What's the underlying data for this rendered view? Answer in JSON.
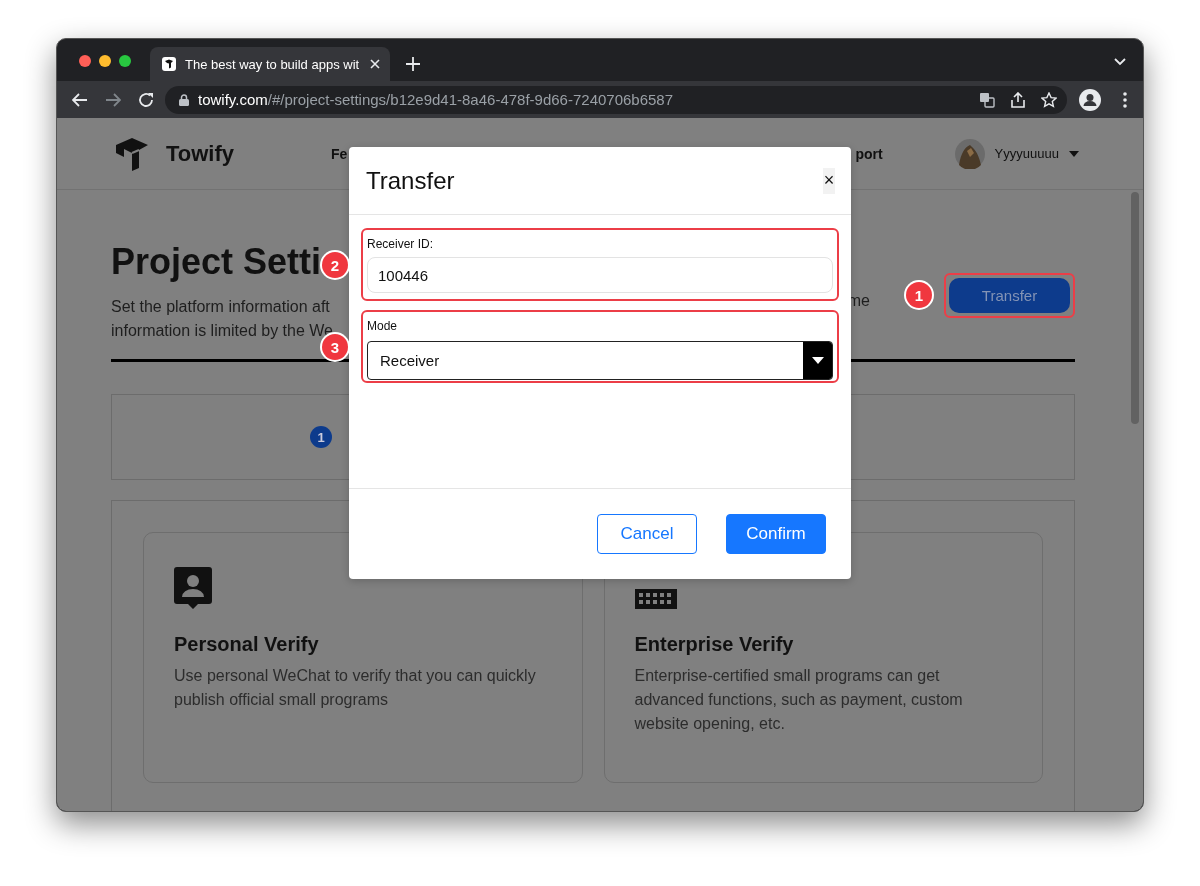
{
  "browser": {
    "tab_title": "The best way to build apps wit",
    "url_host": "towify.com",
    "url_path": "/#/project-settings/b12e9d41-8a46-478f-9d66-7240706b6587",
    "forward_disabled": true
  },
  "header": {
    "brand": "Towify",
    "nav": [
      "Fe",
      "port"
    ],
    "user": "Yyyyuuuuu"
  },
  "page": {
    "title": "Project Setti",
    "description_lines": [
      "Set the platform information aft",
      "information is limited by the We"
    ],
    "description_tail": "me",
    "transfer_button": "Transfer",
    "transfer_callout": "1",
    "step": {
      "number": "1"
    },
    "cards": [
      {
        "kind": "personal",
        "title": "Personal Verify",
        "text": "Use personal WeChat to verify that you can quickly publish official small programs"
      },
      {
        "kind": "enterprise",
        "title": "Enterprise Verify",
        "text": "Enterprise-certified small programs can get advanced functions, such as payment, custom website opening, etc."
      }
    ]
  },
  "modal": {
    "title": "Transfer",
    "close": "×",
    "fields": [
      {
        "kind": "text",
        "label": "Receiver ID:",
        "value": "100446",
        "callout": "2"
      },
      {
        "kind": "select",
        "label": "Mode",
        "value": "Receiver",
        "callout": "3"
      }
    ],
    "buttons": [
      {
        "kind": "secondary",
        "label": "Cancel"
      },
      {
        "kind": "primary",
        "label": "Confirm"
      }
    ]
  }
}
